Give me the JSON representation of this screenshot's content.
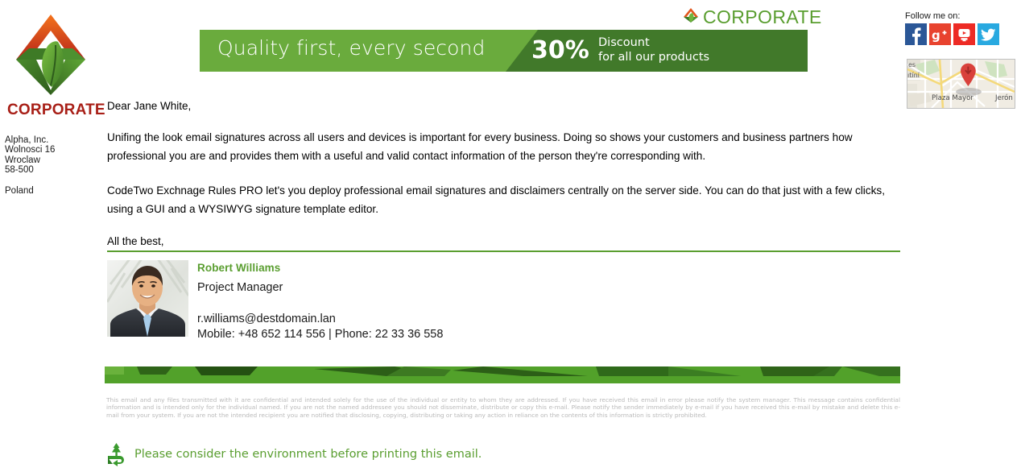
{
  "brand": {
    "wordmark": "CORPORATE",
    "wordmark_color": "#a81f17",
    "accent_green": "#5a9e30",
    "logo_orange": "#e2571e",
    "logo_green": "#4a8b2c"
  },
  "left_column": {
    "address": {
      "company": "Alpha, Inc.",
      "street": "Wolnosci 16",
      "city": "Wroclaw",
      "postal": "58-500",
      "country": "Poland"
    }
  },
  "corporate_mark": {
    "label": "CORPORATE"
  },
  "banner": {
    "slogan": "Quality first, every second",
    "discount_percent": "30%",
    "discount_line1": "Discount",
    "discount_line2": "for all our products",
    "color_light": "#6aab3d",
    "color_dark": "#41792a"
  },
  "social": {
    "label": "Follow  me on:",
    "icons": [
      {
        "name": "facebook-icon",
        "glyph": "f",
        "color": "#2b5797"
      },
      {
        "name": "googleplus-icon",
        "glyph": "g+",
        "color": "#e8432f"
      },
      {
        "name": "youtube-icon",
        "glyph": "youtube",
        "color": "#ed2b25"
      },
      {
        "name": "twitter-icon",
        "glyph": "twitter",
        "color": "#29a9e0"
      }
    ]
  },
  "map": {
    "place_label": "Plaza Mayor",
    "edge_label_right": "Jerón",
    "edge_label_top_left": "es",
    "edge_label_left": "ıtíní",
    "pin_color": "#d9413b"
  },
  "message": {
    "greeting": "Dear Jane White,",
    "paragraph_1": "Unifing the look email signatures across all users and devices is important for every business. Doing so shows your customers and business partners how professional you are and provides them with a useful and valid contact information of the person they're corresponding with.",
    "paragraph_2": "CodeTwo Exchnage Rules PRO let's you deploy professional email signatures and disclaimers centrally on the server side. You can do that just with a few clicks, using a GUI and a WYSIWYG signature template editor.",
    "closing": "All the best,"
  },
  "signature": {
    "name": "Robert Williams",
    "job_title": "Project Manager",
    "email": "r.williams@destdomain.lan",
    "phones": "Mobile:  +48 652 114 556 | Phone: 22 33 36 558"
  },
  "footer": {
    "disclaimer": "This email and any files transmitted with it are confidential and intended solely for the use of the individual or entity to whom they are addressed. If you have received this email in error please notify the system manager. This message contains confidential information and is intended only for the individual named. If you are not the named addressee you should not disseminate, distribute or copy this e-mail. Please notify the sender immediately by e-mail if you have received this e-mail by mistake and delete this e-mail from your system. If you are not the intended recipient you are notified that disclosing, copying, distributing or taking any action in reliance on the contents of this information is strictly prohibited.",
    "environment_note": "Please consider the environment before printing this email."
  }
}
